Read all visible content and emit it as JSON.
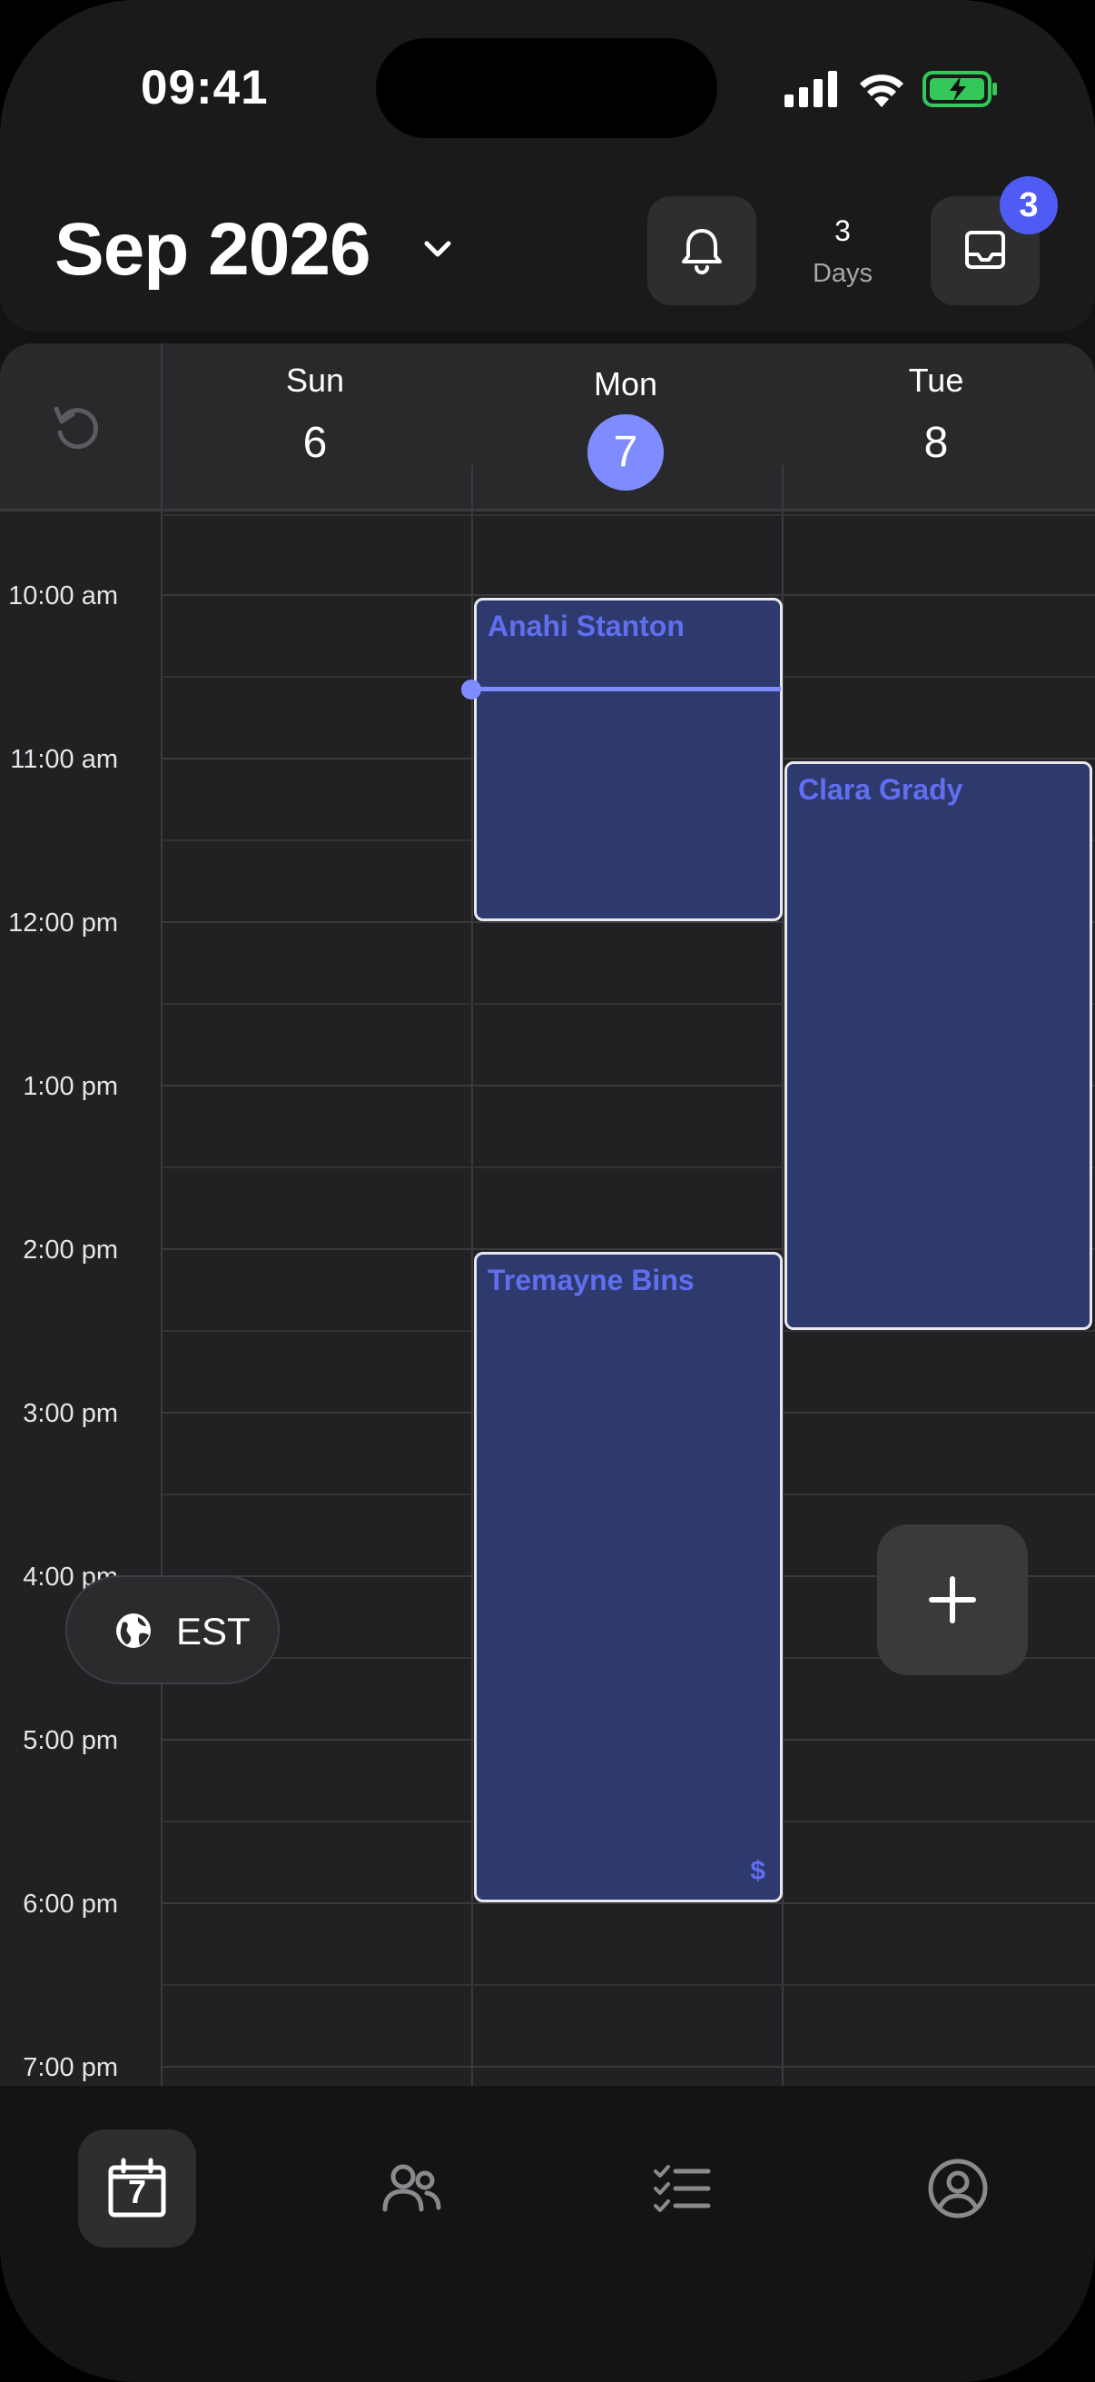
{
  "status": {
    "time": "09:41"
  },
  "header": {
    "month": "Sep 2026",
    "days_count": "3",
    "days_label": "Days",
    "badge": "3"
  },
  "days": [
    {
      "weekday": "Sun",
      "date": "6",
      "selected": false
    },
    {
      "weekday": "Mon",
      "date": "7",
      "selected": true
    },
    {
      "weekday": "Tue",
      "date": "8",
      "selected": false
    }
  ],
  "times": [
    "10:00 am",
    "11:00 am",
    "12:00 pm",
    "1:00 pm",
    "2:00 pm",
    "3:00 pm",
    "4:00 pm",
    "5:00 pm",
    "6:00 pm",
    "7:00 pm"
  ],
  "events": [
    {
      "name": "Anahi Stanton",
      "day": "Mon",
      "start": "10:00 am",
      "end": "12:00 pm",
      "icon": ""
    },
    {
      "name": "Clara Grady",
      "day": "Tue",
      "start": "11:00 am",
      "end": "2:30 pm",
      "icon": ""
    },
    {
      "name": "Tremayne Bins",
      "day": "Mon",
      "start": "2:00 pm",
      "end": "6:00 pm",
      "icon": "$"
    }
  ],
  "timezone": "EST",
  "tabs": [
    {
      "name": "calendar",
      "label": "7"
    },
    {
      "name": "clients",
      "label": ""
    },
    {
      "name": "tasks",
      "label": ""
    },
    {
      "name": "profile",
      "label": ""
    }
  ],
  "colors": {
    "accent": "#7f8cff",
    "event_bg": "#2e3a6e",
    "event_text": "#5f6ff0",
    "badge": "#4f5cf3",
    "dot": "#38d39f"
  }
}
